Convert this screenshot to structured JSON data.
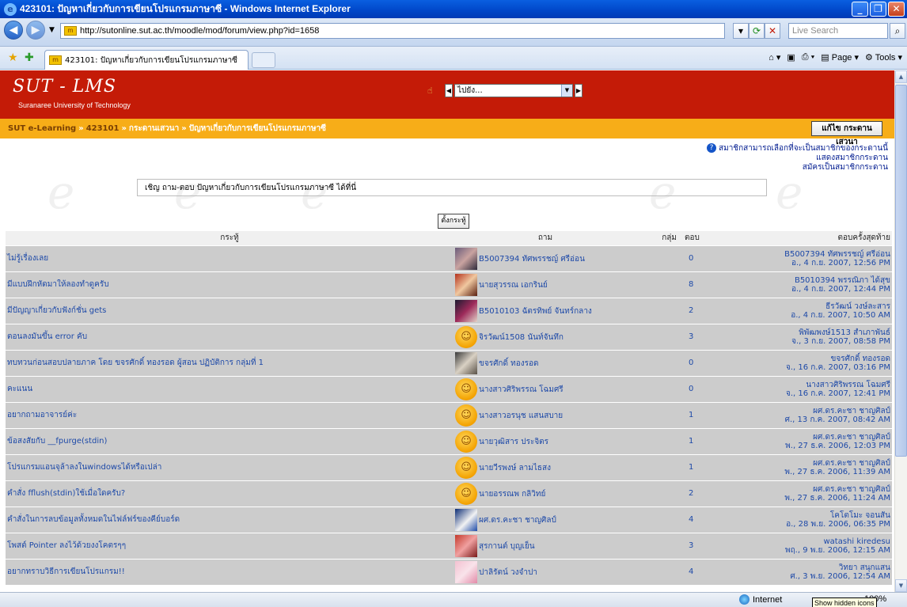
{
  "window": {
    "title": "423101: ปัญหาเกี่ยวกับการเขียนโปรแกรมภาษาซี - Windows Internet Explorer"
  },
  "address": {
    "url": "http://sutonline.sut.ac.th/moodle/mod/forum/view.php?id=1658",
    "search_placeholder": "Live Search"
  },
  "tab": {
    "label": "423101: ปัญหาเกี่ยวกับการเขียนโปรแกรมภาษาซี"
  },
  "commands": {
    "page": "Page",
    "tools": "Tools"
  },
  "site": {
    "logo": "SUT - LMS",
    "subtitle": "Suranaree University of Technology",
    "jump_value": "ไปยัง..."
  },
  "breadcrumb": {
    "items": [
      "SUT e-Learning",
      "423101",
      "กระดานเสวนา",
      "ปัญหาเกี่ยวกับการเขียนโปรแกรมภาษาซี"
    ],
    "edit_button": "แก้ไข กระดานเสวนา"
  },
  "subscription": {
    "line1": "สมาชิกสามารถเลือกที่จะเป็นสมาชิกของกระดานนี้",
    "line2": "แสดงสมาชิกกระดาน",
    "line3": "สมัครเป็นสมาชิกกระดาน"
  },
  "intro": "เชิญ ถาม-ตอบ ปัญหาเกี่ยวกับการเขียนโปรแกรมภาษาซี ได้ที่นี่",
  "new_topic_button": "ตั้งกระทู้",
  "columns": {
    "topic": "กระทู้",
    "starter": "ถาม",
    "group": "กลุ่ม",
    "replies": "ตอบ",
    "last": "ตอบครั้งสุดท้าย"
  },
  "rows": [
    {
      "topic": "ไม่รู้เรื่องเลย",
      "starter": "B5007394 ทัศพรรชญ์ ศรีอ่อน",
      "avatar": "photo",
      "replies": "0",
      "last_name": "B5007394 ทัศพรรชญ์ ศรีอ่อน",
      "last_date": "อ., 4 ก.ย. 2007, 12:56 PM"
    },
    {
      "topic": "มีแบบฝึกหัดมาให้ลองทำดูครับ",
      "starter": "นายสุวรรณ เอกรินย์",
      "avatar": "photo",
      "replies": "8",
      "last_name": "B5010394 พรรณิภา ได้สุข",
      "last_date": "อ., 4 ก.ย. 2007, 12:44 PM"
    },
    {
      "topic": "มีปัญญาเกี่ยวกับฟังก์ชั่น gets",
      "starter": "B5010103 ฉัตรทิพย์ จันทร์กลาง",
      "avatar": "photo",
      "replies": "2",
      "last_name": "ธีรวัฒน์ วงษ์ละสาร",
      "last_date": "อ., 4 ก.ย. 2007, 10:50 AM"
    },
    {
      "topic": "ตอนลงมันขึ้น error คับ",
      "starter": "จิรวัฒน์1508 นันท์จันทึก",
      "avatar": "smiley",
      "replies": "3",
      "last_name": "พิพัฒพงษ์1513 สำเภาพันธ์",
      "last_date": "จ., 3 ก.ย. 2007, 08:58 PM"
    },
    {
      "topic": "ทบทวนก่อนสอบปลายภาค โดย ขจรศักดิ์ ทองรอด ผู้สอน ปฏิบัติการ กลุ่มที่ 1",
      "starter": "ขจรศักดิ์ ทองรอด",
      "avatar": "photo",
      "replies": "0",
      "last_name": "ขจรศักดิ์ ทองรอด",
      "last_date": "จ., 16 ก.ค. 2007, 03:16 PM"
    },
    {
      "topic": "คะแนน",
      "starter": "นางสาวศิริพรรณ โฉมศรี",
      "avatar": "smiley",
      "replies": "0",
      "last_name": "นางสาวศิริพรรณ โฉมศรี",
      "last_date": "จ., 16 ก.ค. 2007, 12:41 PM"
    },
    {
      "topic": "อยากถามอาจารย์ค่ะ",
      "starter": "นางสาวอรนุช แสนสบาย",
      "avatar": "smiley",
      "replies": "1",
      "last_name": "ผศ.ดร.คะชา ชาญศิลป์",
      "last_date": "ศ., 13 ก.ค. 2007, 08:42 AM"
    },
    {
      "topic": "ข้อสงสัยกับ __fpurge(stdin)",
      "starter": "นายวุฒิสาร ประจิตร",
      "avatar": "smiley",
      "replies": "1",
      "last_name": "ผศ.ดร.คะชา ชาญศิลป์",
      "last_date": "พ., 27 ธ.ค. 2006, 12:03 PM"
    },
    {
      "topic": "โปรแกรมแอนจุล้าลงในwindowsได้หรือเปล่า",
      "starter": "นายวีรพงษ์ ลามไธสง",
      "avatar": "smiley",
      "replies": "1",
      "last_name": "ผศ.ดร.คะชา ชาญศิลป์",
      "last_date": "พ., 27 ธ.ค. 2006, 11:39 AM"
    },
    {
      "topic": "คำสั่ง fflush(stdin)ใช้เมื่อใดครับ?",
      "starter": "นายอรรณพ กลิวิทย์",
      "avatar": "smiley",
      "replies": "2",
      "last_name": "ผศ.ดร.คะชา ชาญศิลป์",
      "last_date": "พ., 27 ธ.ค. 2006, 11:24 AM"
    },
    {
      "topic": "คำสั่งในการลบข้อมูลทั้งหมดในไฟล์ฟร์ของคีย์บอร์ด",
      "starter": "ผศ.ดร.คะชา ชาญศิลป์",
      "avatar": "photo",
      "replies": "4",
      "last_name": "โคโตโมะ จอนสัน",
      "last_date": "อ., 28 พ.ย. 2006, 06:35 PM"
    },
    {
      "topic": "โพสต์ Pointer ลงไว้ด้วยงงโคตรๆๆ",
      "starter": "สุรกานต์ บุญเย็น",
      "avatar": "photo",
      "replies": "3",
      "last_name": "watashi kiredesu",
      "last_date": "พฤ., 9 พ.ย. 2006, 12:15 AM"
    },
    {
      "topic": "อยากทราบวิธีการเขียนโปรแกรม!!",
      "starter": "ปาลิรัตน์ วงจำปา",
      "avatar": "photo",
      "replies": "4",
      "last_name": "วิทยา สนุกแสน",
      "last_date": "ศ., 3 พ.ย. 2006, 12:54 AM"
    }
  ],
  "status": {
    "zone": "Internet",
    "zoom": "100%",
    "tooltip": "Show hidden icons"
  }
}
